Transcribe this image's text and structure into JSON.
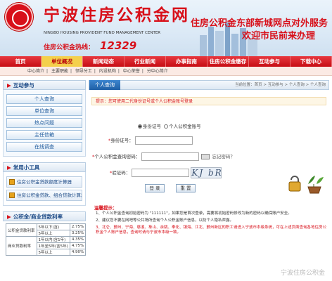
{
  "header": {
    "title": "宁波住房公积金网",
    "subtitle": "NINGBO HOUSING PROVIDENT FUND MANAGEMENT CENTER",
    "hotline_label": "住房公积金热线：",
    "hotline_number": "12329",
    "slogan_line1": "住房公积金东部新城网点对外服务",
    "slogan_line2": "欢迎市民前来办理"
  },
  "nav": {
    "items": [
      "首页",
      "单位概况",
      "新闻动态",
      "行业新闻",
      "办事指南",
      "住房公积金缴存",
      "互动参与",
      "下载中心"
    ],
    "active_index": 1
  },
  "subnav": {
    "items": [
      "中心简介",
      "主要职能",
      "领导分工",
      "内设机构",
      "中心荣誉",
      "分中心简介"
    ]
  },
  "sidebar": {
    "interact": {
      "title": "互动参与",
      "items": [
        "个人查询",
        "单位查询",
        "热点问题",
        "主任信箱",
        "在线调查"
      ]
    },
    "tools": {
      "title": "常用小工具",
      "items": [
        "住房公积金贷款额度计算器",
        "住房公积金贷款、组合贷款计算器"
      ]
    },
    "rates": {
      "title": "公积金/商业贷款利率",
      "rows": [
        [
          "公积金贷款利率",
          "5年以下(含)",
          "2.75%"
        ],
        [
          "",
          "5年以上",
          "3.25%"
        ],
        [
          "商业贷款利率",
          "1年以内(含1年)",
          "4.35%"
        ],
        [
          "",
          "1年至5年(含5年)",
          "4.75%"
        ],
        [
          "",
          "5年以上",
          "4.90%"
        ]
      ]
    }
  },
  "main": {
    "tab_label": "个人查询",
    "breadcrumb": "当前位置：首页 > 互动参与 > 个人查询 > 个人查询",
    "notice": "提示：您可使用二代身份证号或个人公积金账号登录",
    "login_options": [
      "身份证号",
      "个人公积金账号"
    ],
    "selected_option": 0,
    "id_label": "身份证号：",
    "pwd_label": "个人公积金查询密码：",
    "forgot_label": "忘记密码？",
    "captcha_label": "验证码：",
    "captcha_text": "KJ bR",
    "login_button": "登 录",
    "reset_button": "重 置",
    "tips_title": "温馨提示：",
    "tips": [
      "1、个人公积金查询初始密码为 \"111111\"，如果您是首次登录，需要将初始密码修改为新的密码以确保账户安全。",
      "2、建议您不要在网吧等公共场所查询个人公积金账户信息，以防个人隐私泄露。",
      "3、北仑、鄞州、宁海、慈溪、象山、余姚、奉化、镇海、江北、鄞州新区的职工请进入宁波市本级系统，可在上述页面查询各地住房公积金个人账户信息，查询时请与宁波市本级一致。"
    ],
    "watermark": "宁波住房公积金"
  }
}
